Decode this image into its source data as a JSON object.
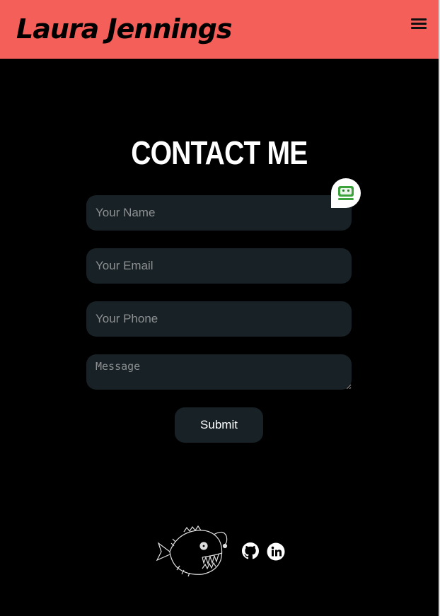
{
  "header": {
    "title": "Laura Jennings",
    "menu_icon": "hamburger-menu-icon",
    "background": "#f55f59"
  },
  "contact": {
    "heading": "CONTACT ME",
    "name_placeholder": "Your Name",
    "email_placeholder": "Your Email",
    "phone_placeholder": "Your Phone",
    "message_placeholder": "Message",
    "submit_label": "Submit",
    "field_background": "#182125"
  },
  "autofill_badge": {
    "icon": "roboform-icon"
  },
  "footer": {
    "logo_icon": "anglerfish-icon",
    "social_icons": [
      "github-icon",
      "linkedin-icon"
    ]
  }
}
